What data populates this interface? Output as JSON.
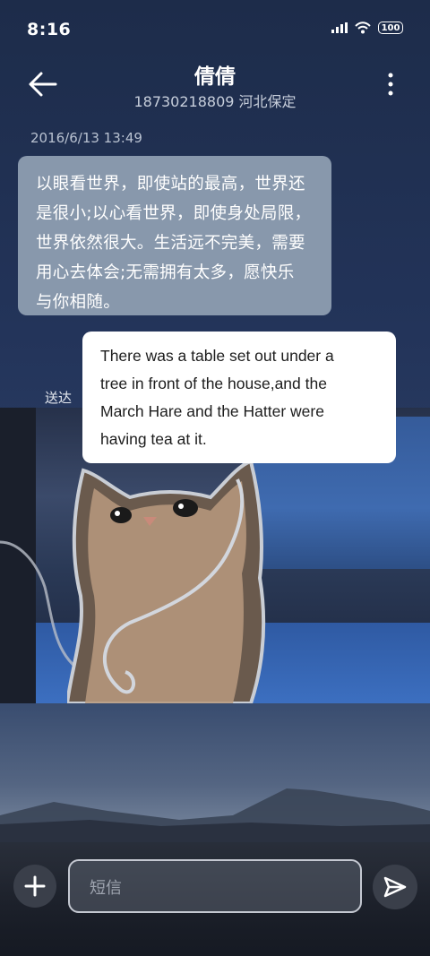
{
  "status_bar": {
    "time": "8:16",
    "battery": "100",
    "icons": [
      "signal-icon",
      "wifi-icon",
      "battery-icon"
    ]
  },
  "header": {
    "contact_name": "倩倩",
    "contact_subtitle": "18730218809 河北保定",
    "icons": [
      "back-arrow-icon",
      "more-vertical-icon"
    ]
  },
  "conversation": {
    "timestamp": "2016/6/13 13:49",
    "messages": [
      {
        "direction": "incoming",
        "lines": [
          "以眼看世界，即使站的最高，世界还",
          "是很小;以心看世界，即使身处局限，",
          "世界依然很大。生活远不完美，需要",
          "用心去体会;无需拥有太多，愿快乐",
          "与你相随。"
        ]
      },
      {
        "direction": "outgoing",
        "lines": [
          "There was a table set out under a",
          "tree in front of the house,and the",
          "March Hare and the Hatter were",
          "having tea at it."
        ],
        "status": "送达"
      }
    ]
  },
  "composer": {
    "placeholder": "短信",
    "icons": [
      "add-icon",
      "send-icon"
    ]
  },
  "colors": {
    "incoming_bubble": "#8898ac",
    "outgoing_bubble": "#ffffff",
    "background_top": "#1d2c4a"
  }
}
